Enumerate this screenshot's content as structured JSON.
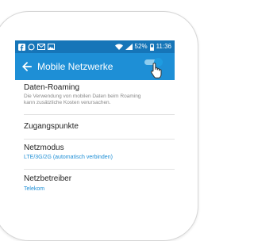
{
  "status_bar": {
    "battery_percent": "52%",
    "time": "11:36",
    "left_icons": [
      "facebook-icon",
      "whatsapp-icon",
      "mail-icon",
      "image-icon"
    ],
    "right_icons": [
      "wifi-icon",
      "signal-icon",
      "battery-icon"
    ]
  },
  "toolbar": {
    "title": "Mobile Netzwerke",
    "back_icon": "arrow-left-icon"
  },
  "settings": {
    "data_roaming": {
      "title": "Daten-Roaming",
      "description": "Die Verwendung von mobilen Daten beim Roaming kann zusätzliche Kosten verursachen.",
      "enabled": true
    },
    "access_points": {
      "title": "Zugangspunkte"
    },
    "network_mode": {
      "title": "Netzmodus",
      "value": "LTE/3G/2G (automatisch verbinden)"
    },
    "network_operator": {
      "title": "Netzbetreiber",
      "value": "Telekom"
    }
  },
  "colors": {
    "status_bar": "#1675b8",
    "toolbar": "#1e8fd6",
    "accent": "#1e8fd6",
    "toggle_track": "#8fcdef",
    "toggle_knob": "#1e9be0"
  }
}
